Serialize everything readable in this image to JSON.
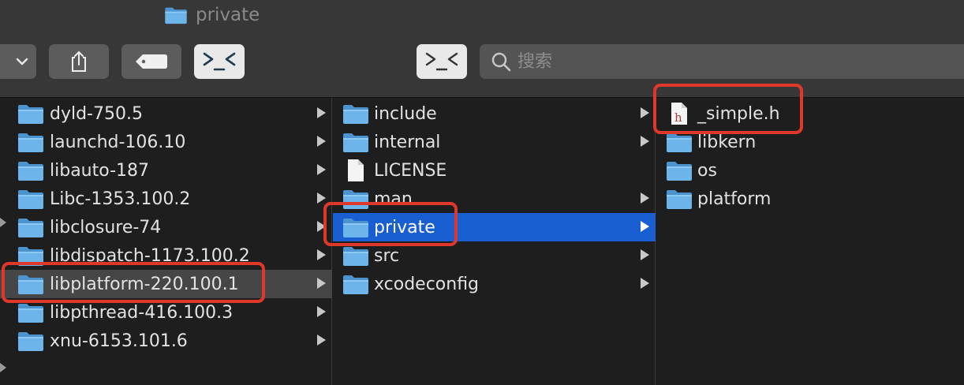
{
  "window": {
    "title": "private"
  },
  "toolbar": {
    "view_dropdown_icon": "chevron-down-icon",
    "share_icon": "share-icon",
    "tag_icon": "tag-icon",
    "terminal_icon": "terminal-face-icon"
  },
  "search": {
    "placeholder": "搜索"
  },
  "columns": {
    "col1": [
      {
        "label": "dyld-750.5"
      },
      {
        "label": "launchd-106.10"
      },
      {
        "label": "libauto-187"
      },
      {
        "label": "Libc-1353.100.2"
      },
      {
        "label": "libclosure-74"
      },
      {
        "label": "libdispatch-1173.100.2"
      },
      {
        "label": "libplatform-220.100.1",
        "selected": true
      },
      {
        "label": "libpthread-416.100.3"
      },
      {
        "label": "xnu-6153.101.6"
      }
    ],
    "col2": [
      {
        "label": "include",
        "type": "folder"
      },
      {
        "label": "internal",
        "type": "folder"
      },
      {
        "label": "LICENSE",
        "type": "file"
      },
      {
        "label": "man",
        "type": "folder"
      },
      {
        "label": "private",
        "type": "folder",
        "selected": true
      },
      {
        "label": "src",
        "type": "folder"
      },
      {
        "label": "xcodeconfig",
        "type": "folder"
      }
    ],
    "col3": [
      {
        "label": "_simple.h",
        "type": "header-file"
      },
      {
        "label": "libkern",
        "type": "folder"
      },
      {
        "label": "os",
        "type": "folder"
      },
      {
        "label": "platform",
        "type": "folder"
      }
    ]
  },
  "colors": {
    "selection_blue": "#1a5fd2",
    "annotation_red": "#e0372b",
    "folder_blue": "#5ba8e2"
  }
}
